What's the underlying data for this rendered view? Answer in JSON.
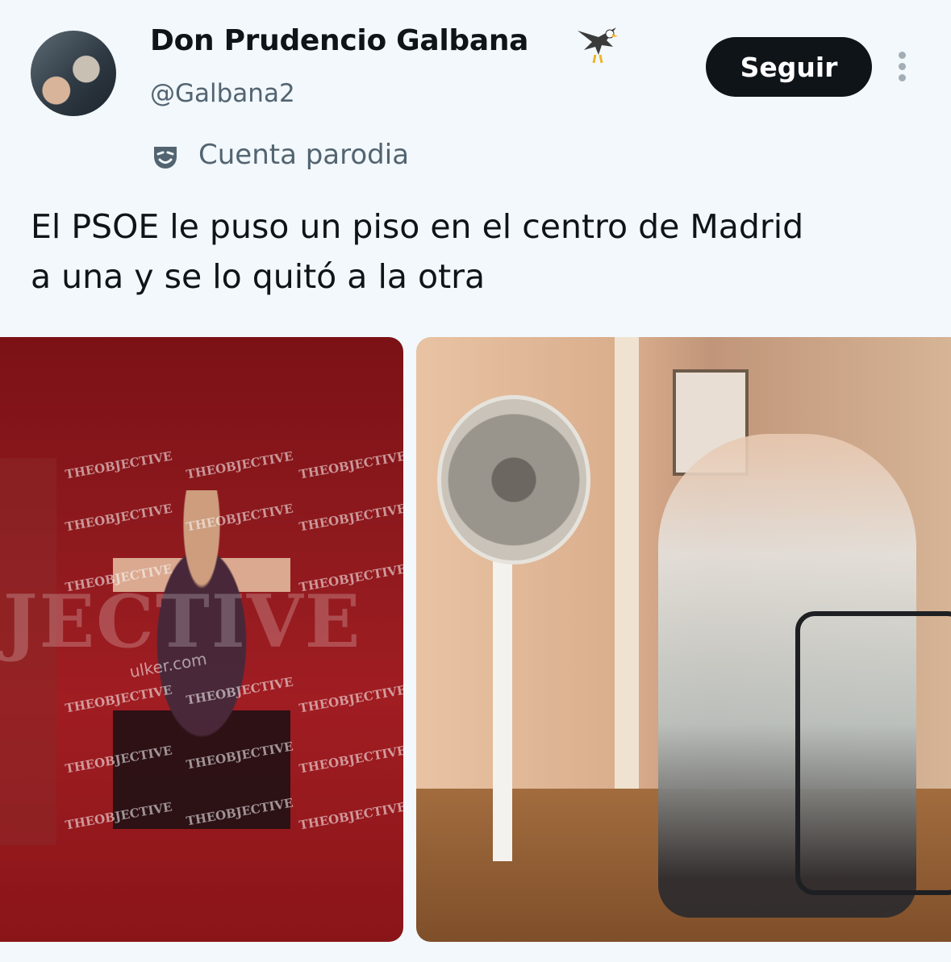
{
  "profile": {
    "display_name": "Don Prudencio Galbana",
    "handle": "@Galbana2",
    "badge_label": "Cuenta parodia",
    "follow_label": "Seguir",
    "name_emoji": "eagle-icon"
  },
  "tweet": {
    "text": "El PSOE le puso un piso en el centro de Madrid\na una y se lo quitó a la otra"
  },
  "media": {
    "left_watermark": "THEOBJECTIVE",
    "left_watermark_big": "JECTIVE",
    "left_watermark_site": "ulker.com"
  },
  "colors": {
    "follow_button_bg": "#0f1419",
    "secondary_text": "#536471",
    "background": "#f2f8fb"
  }
}
